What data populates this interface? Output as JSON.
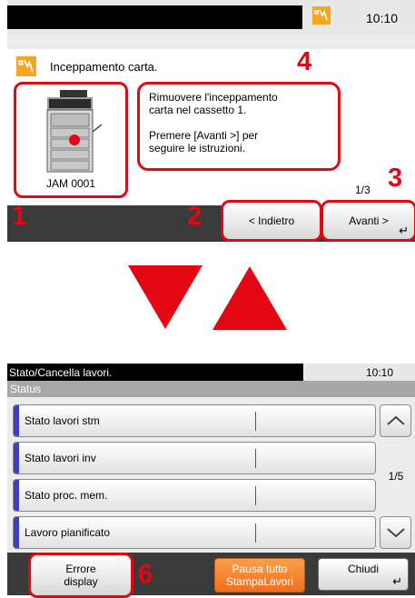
{
  "top_screen": {
    "time": "10:10",
    "message_title": "Inceppamento carta.",
    "jam_code": "JAM 0001",
    "instructions": [
      "Rimuovere l'inceppamento",
      "carta nel cassetto 1.",
      "",
      "Premere [Avanti >] per",
      "seguire le istruzioni."
    ],
    "page_indicator": "1/3",
    "back_button": "< Indietro",
    "next_button": "Avanti >"
  },
  "callouts": {
    "n1": "1",
    "n2": "2",
    "n3": "3",
    "n4": "4",
    "n6": "6"
  },
  "bottom_screen": {
    "title": "Stato/Cancella lavori.",
    "time": "10:10",
    "status_label": "Status",
    "rows": [
      {
        "label": "Stato lavori stm"
      },
      {
        "label": "Stato lavori inv"
      },
      {
        "label": "Stato proc. mem."
      },
      {
        "label": "Lavoro pianificato"
      }
    ],
    "page_indicator": "1/5",
    "error_button_line1": "Errore",
    "error_button_line2": "display",
    "pause_button_line1": "Pausa tutto",
    "pause_button_line2": "StampaLavori",
    "close_button": "Chiudi"
  },
  "colors": {
    "highlight": "#e30613",
    "jam_icon": "#f5a623",
    "row_accent": "#3b3fc0",
    "pause_button": "#f26f1d",
    "bottom_bar": "#3a3a3a"
  },
  "icons": [
    "paper-jam-icon",
    "enter-icon",
    "scroll-up-icon",
    "scroll-down-icon",
    "printer-illustration"
  ]
}
